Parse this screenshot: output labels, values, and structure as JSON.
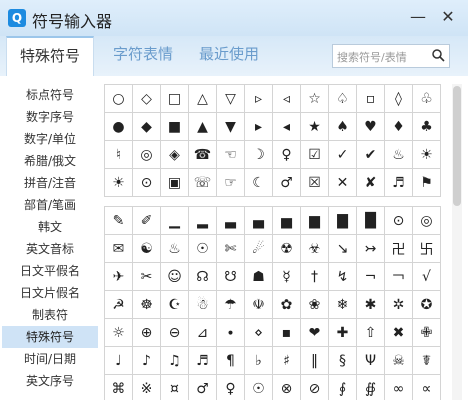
{
  "window": {
    "title": "符号输入器",
    "app_icon_letter": "Q",
    "minimize_glyph": "—",
    "close_glyph": "✕"
  },
  "tabs": [
    {
      "label": "特殊符号",
      "active": true
    },
    {
      "label": "字符表情",
      "active": false
    },
    {
      "label": "最近使用",
      "active": false
    }
  ],
  "search": {
    "placeholder": "搜索符号/表情"
  },
  "categories": [
    {
      "label": "标点符号"
    },
    {
      "label": "数字序号"
    },
    {
      "label": "数字/单位"
    },
    {
      "label": "希腊/俄文"
    },
    {
      "label": "拼音/注音"
    },
    {
      "label": "部首/笔画"
    },
    {
      "label": "韩文"
    },
    {
      "label": "英文音标"
    },
    {
      "label": "日文平假名"
    },
    {
      "label": "日文片假名"
    },
    {
      "label": "制表符"
    },
    {
      "label": "特殊符号",
      "active": true
    },
    {
      "label": "时间/日期"
    },
    {
      "label": "英文序号"
    }
  ],
  "symbols_group1": [
    "○",
    "◇",
    "□",
    "△",
    "▽",
    "▹",
    "◃",
    "☆",
    "♤",
    "▫",
    "◊",
    "♧",
    "●",
    "◆",
    "■",
    "▲",
    "▼",
    "▸",
    "◂",
    "★",
    "♠",
    "♥",
    "♦",
    "♣",
    "♮",
    "◎",
    "◈",
    "☎",
    "☜",
    "☽",
    "♀",
    "☑",
    "✓",
    "✔",
    "♨",
    "☀",
    "☀",
    "⊙",
    "▣",
    "☏",
    "☞",
    "☾",
    "♂",
    "☒",
    "✕",
    "✘",
    "♬",
    "⚑"
  ],
  "symbols_group2": [
    "✎",
    "✐",
    "▁",
    "▂",
    "▃",
    "▄",
    "▅",
    "▆",
    "▇",
    "█",
    "⊙",
    "◎",
    "✉",
    "☯",
    "♨",
    "☉",
    "✄",
    "☄",
    "☢",
    "☣",
    "↘",
    "↣",
    "卍",
    "卐",
    "✈",
    "✂",
    "☺",
    "☊",
    "☋",
    "☗",
    "☿",
    "†",
    "↯",
    "¬",
    "￢",
    "√",
    "☭",
    "☸",
    "☪",
    "☃",
    "☂",
    "☫",
    "✿",
    "❀",
    "❄",
    "✱",
    "✲",
    "✪",
    "☼",
    "⊕",
    "⊖",
    "⊿",
    "∙",
    "⋄",
    "▪",
    "❤",
    "✚",
    "⇧",
    "✖",
    "✙",
    "♩",
    "♪",
    "♫",
    "♬",
    "¶",
    "♭",
    "♯",
    "‖",
    "§",
    "Ψ",
    "☠",
    "☤",
    "⌘",
    "※",
    "¤",
    "♂",
    "♀",
    "☉",
    "⊗",
    "⊘",
    "∮",
    "∯",
    "∞",
    "∝"
  ],
  "icons": {
    "search": "search-icon",
    "app": "app-icon"
  },
  "colors": {
    "accent": "#1d8be0",
    "active_category_bg": "#cfe3f6",
    "tab_inactive": "#6a9ccc"
  }
}
